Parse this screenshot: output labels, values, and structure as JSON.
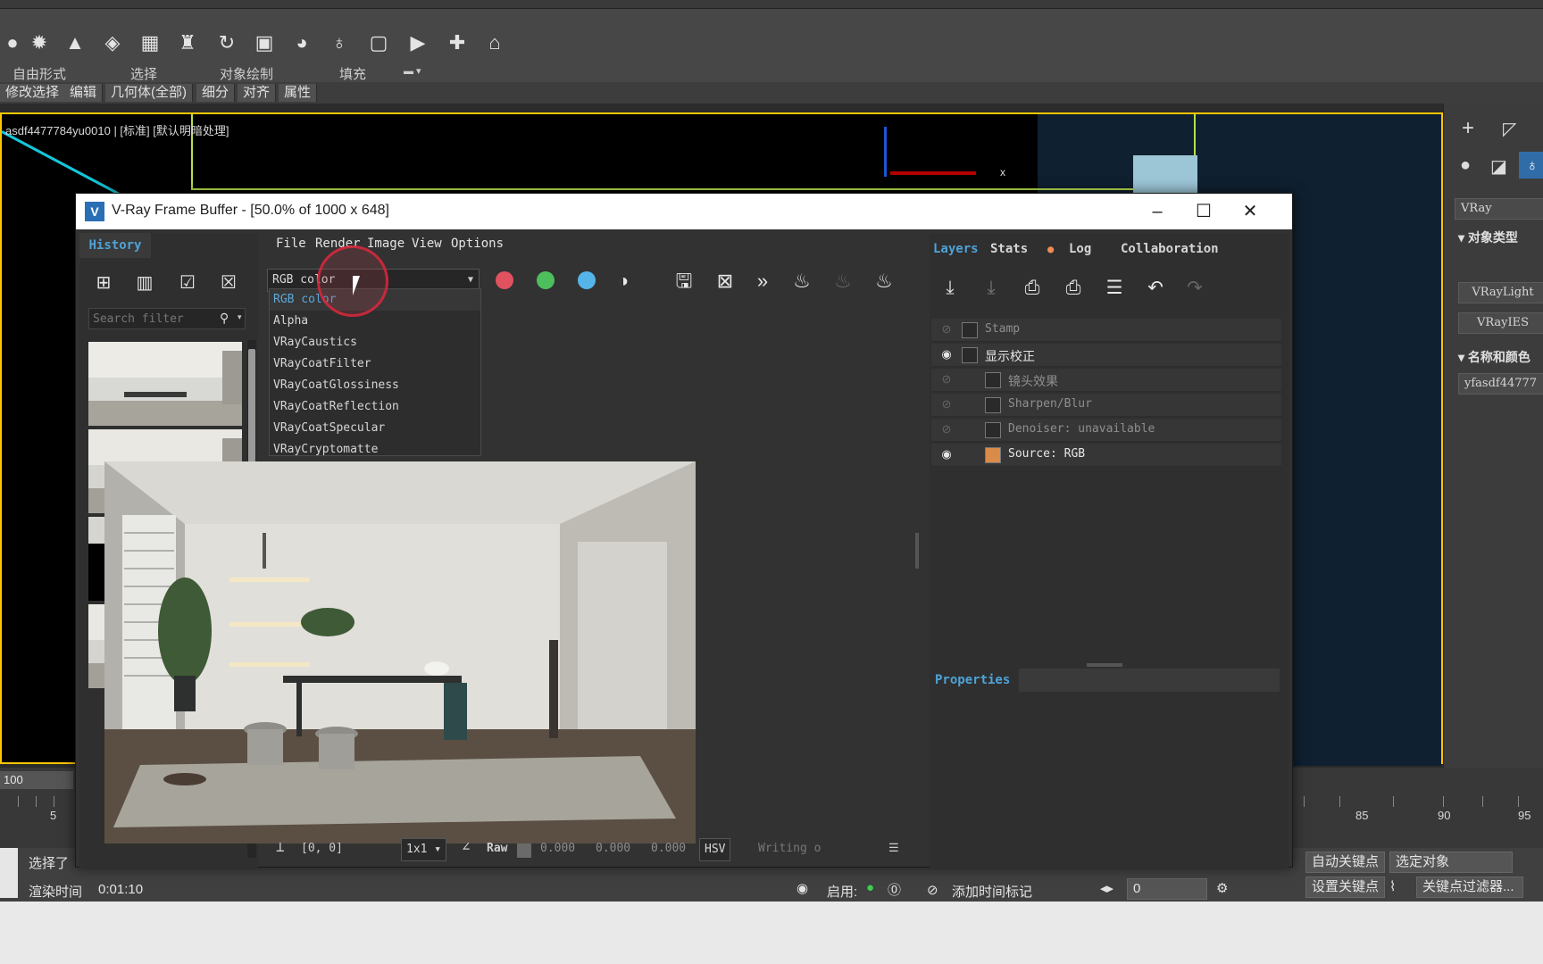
{
  "max": {
    "ribbon_labels": [
      "自由形式",
      "选择",
      "对象绘制",
      "填充"
    ],
    "mod_tabs": [
      "修改选择",
      "编辑",
      "几何体(全部)",
      "细分",
      "对齐",
      "属性"
    ],
    "viewport_title": "asdf4477784yu0010 | [标准] [默认明暗处理]",
    "viewport_axis_label": "x",
    "right_panel": {
      "renderer": "VRay",
      "section_object_type": "对象类型",
      "btn_vraylight": "VRayLight",
      "btn_vrayies": "VRayIES",
      "section_name_color": "名称和颜色",
      "object_name": "yfasdf44777"
    },
    "timeline": {
      "frame_label": "100",
      "ticks": [
        "5",
        "85",
        "90",
        "95"
      ]
    },
    "status": {
      "selected_text": "选择了",
      "render_time_label": "渲染时间",
      "render_time_value": "0:01:10",
      "enable_label": "启用:",
      "add_time_tag": "添加时间标记",
      "frame_value": "0",
      "auto_key": "自动关键点",
      "set_key": "设置关键点",
      "selected_object": "选定对象",
      "key_filters": "关键点过滤器..."
    }
  },
  "vfb": {
    "title": "V-Ray Frame Buffer - [50.0% of 1000 x 648]",
    "history_tab": "History",
    "search_placeholder": "Search filter",
    "menu": [
      "File",
      "Render",
      "Image",
      "View",
      "Options"
    ],
    "channel_selected": "RGB color",
    "channel_options": [
      "RGB color",
      "Alpha",
      "VRayCaustics",
      "VRayCoatFilter",
      "VRayCoatGlossiness",
      "VRayCoatReflection",
      "VRayCoatSpecular",
      "VRayCryptomatte"
    ],
    "channel_dots": {
      "red": "#e0525f",
      "green": "#4dbf5c",
      "blue": "#55b5e8"
    },
    "bottom": {
      "coords": "[0, 0]",
      "zoom": "1x1",
      "raw_label": "Raw",
      "values": [
        "0.000",
        "0.000",
        "0.000"
      ],
      "color_mode": "HSV",
      "status": "Writing o"
    },
    "layer_tabs": [
      "Layers",
      "Stats",
      "Log",
      "Collaboration"
    ],
    "layers": [
      {
        "name": "Stamp",
        "visible": false
      },
      {
        "name": "显示校正",
        "visible": true
      },
      {
        "name": "镜头效果",
        "visible": false
      },
      {
        "name": "Sharpen/Blur",
        "visible": false
      },
      {
        "name": "Denoiser: unavailable",
        "visible": false
      },
      {
        "name": "Source: RGB",
        "visible": true
      }
    ],
    "properties_tab": "Properties"
  },
  "colors": {
    "accent_blue": "#4fa3d8",
    "viewport_border": "#ffc700"
  }
}
